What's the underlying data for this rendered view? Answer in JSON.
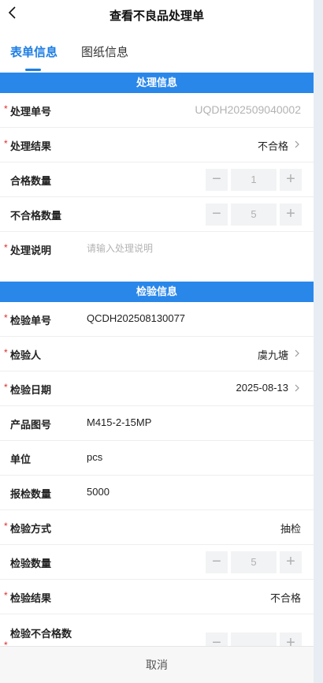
{
  "nav": {
    "title": "查看不良品处理单"
  },
  "tabs": [
    {
      "label": "表单信息",
      "active": true
    },
    {
      "label": "图纸信息",
      "active": false
    }
  ],
  "sections": {
    "processing": {
      "title": "处理信息",
      "order_no_label": "处理单号",
      "order_no_value": "UQDH202509040002",
      "result_label": "处理结果",
      "result_value": "不合格",
      "qualified_qty_label": "合格数量",
      "qualified_qty_value": "1",
      "unqualified_qty_label": "不合格数量",
      "unqualified_qty_value": "5",
      "desc_label": "处理说明",
      "desc_placeholder": "请输入处理说明"
    },
    "inspection": {
      "title": "检验信息",
      "order_no_label": "检验单号",
      "order_no_value": "QCDH202508130077",
      "inspector_label": "检验人",
      "inspector_value": "虞九塘",
      "date_label": "检验日期",
      "date_value": "2025-08-13",
      "drawing_label": "产品图号",
      "drawing_value": "M415-2-15MP",
      "unit_label": "单位",
      "unit_value": "pcs",
      "report_qty_label": "报检数量",
      "report_qty_value": "5000",
      "method_label": "检验方式",
      "method_value": "抽检",
      "inspect_qty_label": "检验数量",
      "inspect_qty_value": "5",
      "inspect_result_label": "检验结果",
      "inspect_result_value": "不合格",
      "inspect_unqualified_label": "检验不合格数"
    }
  },
  "stepper": {
    "minus": "−",
    "plus": "+"
  },
  "required_mark": "*",
  "footer": {
    "cancel_label": "取消"
  },
  "colors": {
    "accent": "#2a87ea",
    "tab_active": "#1e7ee3",
    "required": "#e02c2c"
  }
}
